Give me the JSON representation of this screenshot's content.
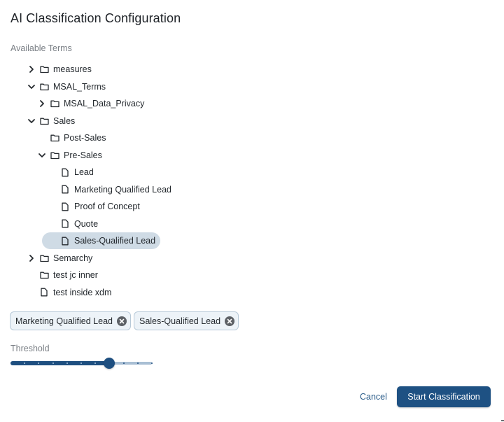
{
  "dialog": {
    "title": "AI Classification Configuration"
  },
  "terms": {
    "label": "Available Terms",
    "tree": [
      {
        "label": "measures",
        "type": "folder",
        "level": 0,
        "expander": "collapsed",
        "selected": false
      },
      {
        "label": "MSAL_Terms",
        "type": "folder",
        "level": 0,
        "expander": "expanded",
        "selected": false
      },
      {
        "label": "MSAL_Data_Privacy",
        "type": "folder",
        "level": 1,
        "expander": "collapsed",
        "selected": false
      },
      {
        "label": "Sales",
        "type": "folder",
        "level": 0,
        "expander": "expanded",
        "selected": false
      },
      {
        "label": "Post-Sales",
        "type": "folder",
        "level": 1,
        "expander": "none",
        "selected": false
      },
      {
        "label": "Pre-Sales",
        "type": "folder",
        "level": 1,
        "expander": "expanded",
        "selected": false
      },
      {
        "label": "Lead",
        "type": "file",
        "level": 2,
        "expander": "none",
        "selected": false
      },
      {
        "label": "Marketing Qualified Lead",
        "type": "file",
        "level": 2,
        "expander": "none",
        "selected": false
      },
      {
        "label": "Proof of Concept",
        "type": "file",
        "level": 2,
        "expander": "none",
        "selected": false
      },
      {
        "label": "Quote",
        "type": "file",
        "level": 2,
        "expander": "none",
        "selected": false
      },
      {
        "label": "Sales-Qualified Lead",
        "type": "file",
        "level": 2,
        "expander": "none",
        "selected": true
      },
      {
        "label": "Semarchy",
        "type": "folder",
        "level": 0,
        "expander": "collapsed",
        "selected": false
      },
      {
        "label": "test jc inner",
        "type": "folder",
        "level": 0,
        "expander": "none",
        "selected": false
      },
      {
        "label": "test inside xdm",
        "type": "file",
        "level": 0,
        "expander": "none",
        "selected": false
      }
    ]
  },
  "selected_chips": [
    {
      "label": "Marketing Qualified Lead",
      "icon": "close-circle-icon"
    },
    {
      "label": "Sales-Qualified Lead",
      "icon": "close-circle-icon"
    }
  ],
  "threshold": {
    "label": "Threshold",
    "value": 0.7,
    "min": 0,
    "max": 1,
    "step": 0.1
  },
  "actions": {
    "cancel_label": "Cancel",
    "start_label": "Start Classification"
  },
  "colors": {
    "accent": "#1e5183",
    "selected_row": "#cfdbe5",
    "chip_bg": "#edf3f8",
    "chip_border": "#b7c9d8",
    "muted_text": "#7a7f85"
  }
}
